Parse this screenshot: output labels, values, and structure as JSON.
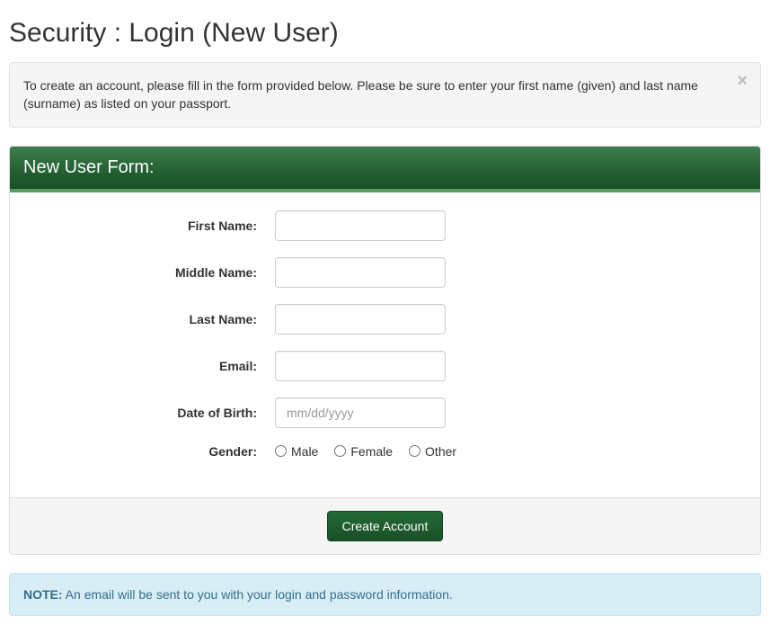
{
  "page": {
    "title": "Security : Login (New User)"
  },
  "instruction_alert": {
    "text": "To create an account, please fill in the form provided below. Please be sure to enter your first name (given) and last name (surname) as listed on your passport.",
    "close_label": "×"
  },
  "panel": {
    "heading": "New User Form:"
  },
  "form": {
    "first_name": {
      "label": "First Name:",
      "value": ""
    },
    "middle_name": {
      "label": "Middle Name:",
      "value": ""
    },
    "last_name": {
      "label": "Last Name:",
      "value": ""
    },
    "email": {
      "label": "Email:",
      "value": ""
    },
    "dob": {
      "label": "Date of Birth:",
      "value": "",
      "placeholder": "mm/dd/yyyy"
    },
    "gender": {
      "label": "Gender:",
      "options": {
        "male": "Male",
        "female": "Female",
        "other": "Other"
      },
      "selected": ""
    }
  },
  "footer": {
    "submit_label": "Create Account"
  },
  "note_alert": {
    "prefix": "NOTE:",
    "text": " An email will be sent to you with your login and password information."
  }
}
